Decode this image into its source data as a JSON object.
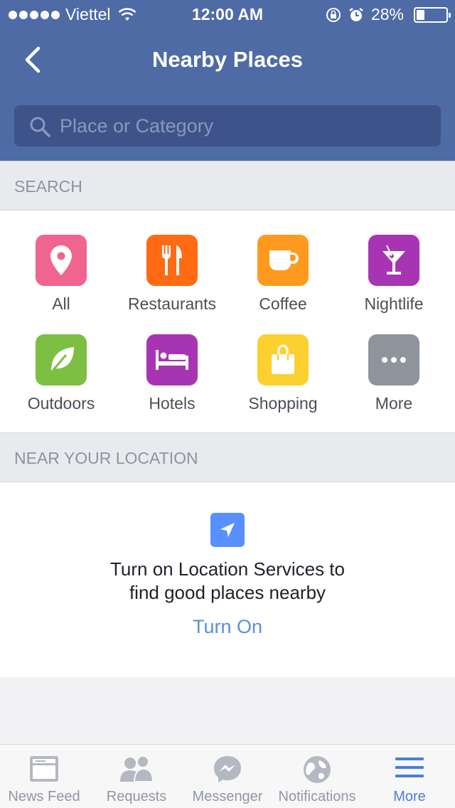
{
  "status_bar": {
    "carrier": "Viettel",
    "time": "12:00 AM",
    "battery": "28%",
    "battery_level": 0.28
  },
  "header": {
    "title": "Nearby Places",
    "back_icon": "chevron-left-icon"
  },
  "search": {
    "placeholder": "Place or Category",
    "value": ""
  },
  "sections": {
    "search_header": "SEARCH",
    "near_header": "NEAR YOUR LOCATION"
  },
  "categories": [
    {
      "label": "All",
      "icon": "map-pin-icon",
      "color": "#f0658f"
    },
    {
      "label": "Restaurants",
      "icon": "fork-knife-icon",
      "color": "#ff6a13"
    },
    {
      "label": "Coffee",
      "icon": "coffee-cup-icon",
      "color": "#ff9a1f"
    },
    {
      "label": "Nightlife",
      "icon": "cocktail-icon",
      "color": "#a734b3"
    },
    {
      "label": "Outdoors",
      "icon": "leaf-icon",
      "color": "#7cbf42"
    },
    {
      "label": "Hotels",
      "icon": "bed-icon",
      "color": "#a734b3"
    },
    {
      "label": "Shopping",
      "icon": "shopping-bag-icon",
      "color": "#fcd02f"
    },
    {
      "label": "More",
      "icon": "ellipsis-icon",
      "color": "#8d949e"
    }
  ],
  "location": {
    "message_line1": "Turn on Location Services to",
    "message_line2": "find good places nearby",
    "action": "Turn On",
    "icon": "location-arrow-icon"
  },
  "tabs": [
    {
      "label": "News Feed",
      "icon": "news-feed-icon",
      "active": false
    },
    {
      "label": "Requests",
      "icon": "friends-icon",
      "active": false
    },
    {
      "label": "Messenger",
      "icon": "messenger-icon",
      "active": false
    },
    {
      "label": "Notifications",
      "icon": "globe-icon",
      "active": false
    },
    {
      "label": "More",
      "icon": "hamburger-menu-icon",
      "active": true
    }
  ],
  "colors": {
    "brand_blue": "#4e6ba6",
    "link_blue": "#5890d7",
    "active_tab": "#4a7fd8"
  }
}
